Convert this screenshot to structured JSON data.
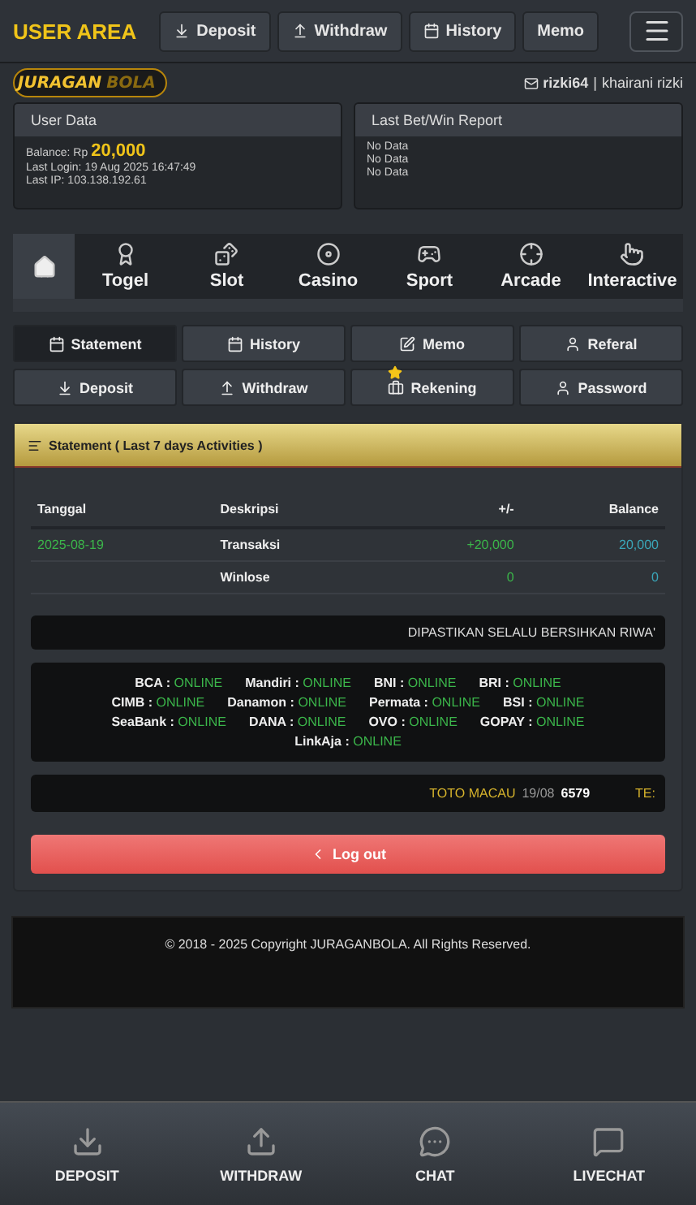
{
  "top_bar": {
    "title": "USER AREA",
    "buttons": [
      {
        "label": "Deposit"
      },
      {
        "label": "Withdraw"
      },
      {
        "label": "History"
      },
      {
        "label": "Memo"
      }
    ]
  },
  "logo": {
    "part1": "JURAGAN",
    "part2": "BOLA"
  },
  "user": {
    "username": "rizki64",
    "separator": "|",
    "full_name": "khairani rizki"
  },
  "user_data": {
    "title": "User Data",
    "balance_label": "Balance: Rp",
    "balance": "20,000",
    "last_login": "Last Login: 19 Aug 2025 16:47:49",
    "last_ip": "Last IP: 103.138.192.61"
  },
  "report": {
    "title": "Last Bet/Win Report",
    "lines": [
      "No Data",
      "No Data",
      "No Data"
    ]
  },
  "game_tabs": [
    {
      "selected": true
    },
    {
      "label": "Togel",
      "selected": false
    },
    {
      "label": "Slot",
      "selected": false
    },
    {
      "label": "Casino",
      "selected": false
    },
    {
      "label": "Sport",
      "selected": false
    },
    {
      "label": "Arcade",
      "selected": false
    },
    {
      "label": "Interactive",
      "selected": false
    }
  ],
  "menu": [
    {
      "label": "Statement",
      "selected": true
    },
    {
      "label": "History",
      "selected": false
    },
    {
      "label": "Memo",
      "selected": false
    },
    {
      "label": "Referal",
      "selected": false
    },
    {
      "label": "Deposit",
      "selected": false
    },
    {
      "label": "Withdraw",
      "selected": false
    },
    {
      "label": "Rekening",
      "selected": false
    },
    {
      "label": "Password",
      "selected": false
    }
  ],
  "statement": {
    "title": "Statement ( Last 7 days Activities )",
    "columns": [
      "Tanggal",
      "Deskripsi",
      "+/-",
      "Balance"
    ],
    "rows": [
      [
        "2025-08-19",
        "Transaksi",
        "+20,000",
        "20,000"
      ],
      [
        "",
        "Winlose",
        "0",
        "0"
      ]
    ]
  },
  "notice": "DIPASTIKAN SELALU BERSIHKAN RIWA'",
  "banks": [
    {
      "name": "BCA",
      "separator": ":",
      "status": "ONLINE"
    },
    {
      "name": "Mandiri",
      "separator": ":",
      "status": "ONLINE"
    },
    {
      "name": "BNI",
      "separator": ":",
      "status": "ONLINE"
    },
    {
      "name": "BRI",
      "separator": ":",
      "status": "ONLINE"
    },
    {
      "name": "CIMB",
      "separator": ":",
      "status": "ONLINE"
    },
    {
      "name": "Danamon",
      "separator": ":",
      "status": "ONLINE"
    },
    {
      "name": "Permata",
      "separator": ":",
      "status": "ONLINE"
    },
    {
      "name": "BSI",
      "separator": ":",
      "status": "ONLINE"
    },
    {
      "name": "SeaBank",
      "separator": ":",
      "status": "ONLINE"
    },
    {
      "name": "DANA",
      "separator": ":",
      "status": "ONLINE"
    },
    {
      "name": "OVO",
      "separator": ":",
      "status": "ONLINE"
    },
    {
      "name": "GOPAY",
      "separator": ":",
      "status": "ONLINE"
    },
    {
      "name": "LinkAja",
      "separator": ":",
      "status": "ONLINE"
    }
  ],
  "results_ticker": {
    "market": "TOTO MACAU",
    "date": "19/08",
    "number": "6579",
    "next": "TE:"
  },
  "logout_button": {
    "label": "Log out"
  },
  "footer": "© 2018 - 2025 Copyright JURAGANBOLA. All Rights Reserved.",
  "bottom_nav": [
    {
      "label": "DEPOSIT"
    },
    {
      "label": "WITHDRAW"
    },
    {
      "label": "CHAT"
    },
    {
      "label": "LIVECHAT"
    }
  ]
}
